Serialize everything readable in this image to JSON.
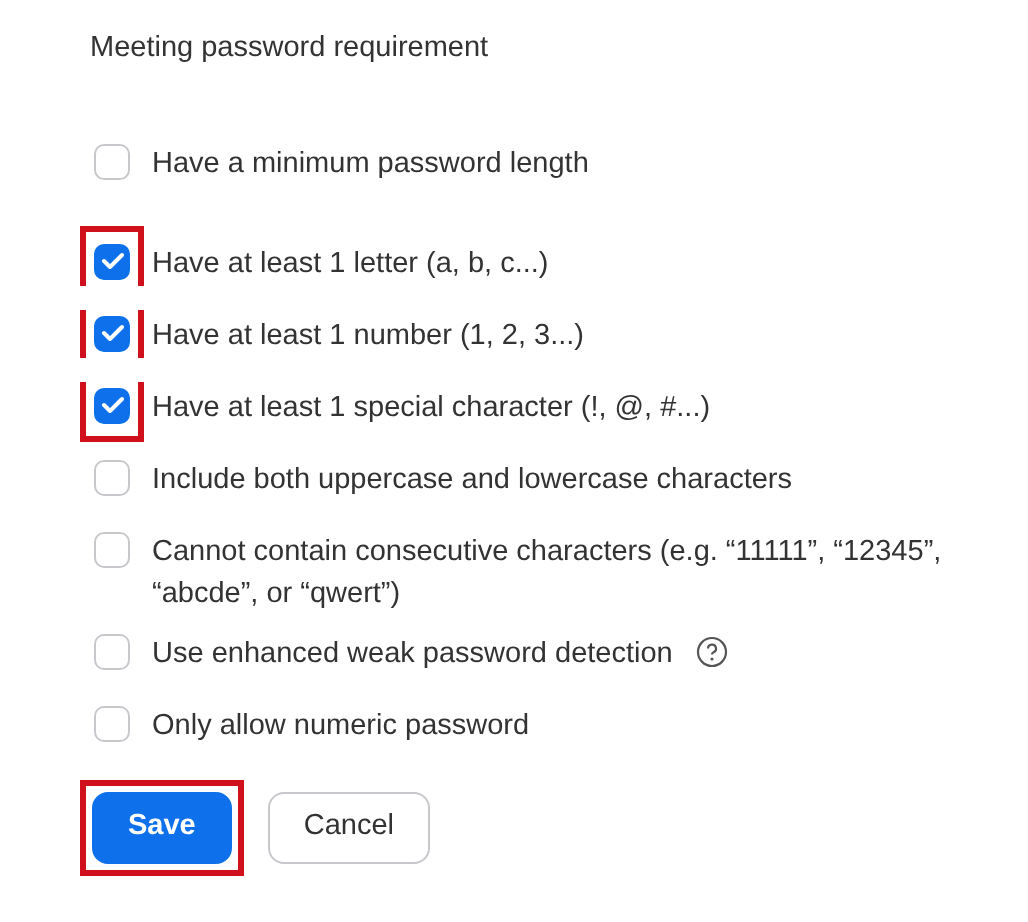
{
  "title": "Meeting password requirement",
  "options": [
    {
      "label": "Have a minimum password length",
      "checked": false,
      "highlighted": false,
      "help": false
    },
    {
      "label": "Have at least 1 letter (a, b, c...)",
      "checked": true,
      "highlighted": true,
      "help": false
    },
    {
      "label": "Have at least 1 number (1, 2, 3...)",
      "checked": true,
      "highlighted": true,
      "help": false
    },
    {
      "label": "Have at least 1 special character (!, @, #...)",
      "checked": true,
      "highlighted": true,
      "help": false
    },
    {
      "label": "Include both uppercase and lowercase characters",
      "checked": false,
      "highlighted": false,
      "help": false
    },
    {
      "label": "Cannot contain consecutive characters (e.g. “11111”, “12345”, “abcde”, or “qwert”)",
      "checked": false,
      "highlighted": false,
      "help": false
    },
    {
      "label": "Use enhanced weak password detection",
      "checked": false,
      "highlighted": false,
      "help": true
    },
    {
      "label": "Only allow numeric password",
      "checked": false,
      "highlighted": false,
      "help": false
    }
  ],
  "buttons": [
    {
      "label": "Save",
      "kind": "primary",
      "highlighted": true
    },
    {
      "label": "Cancel",
      "kind": "secondary",
      "highlighted": false
    }
  ]
}
